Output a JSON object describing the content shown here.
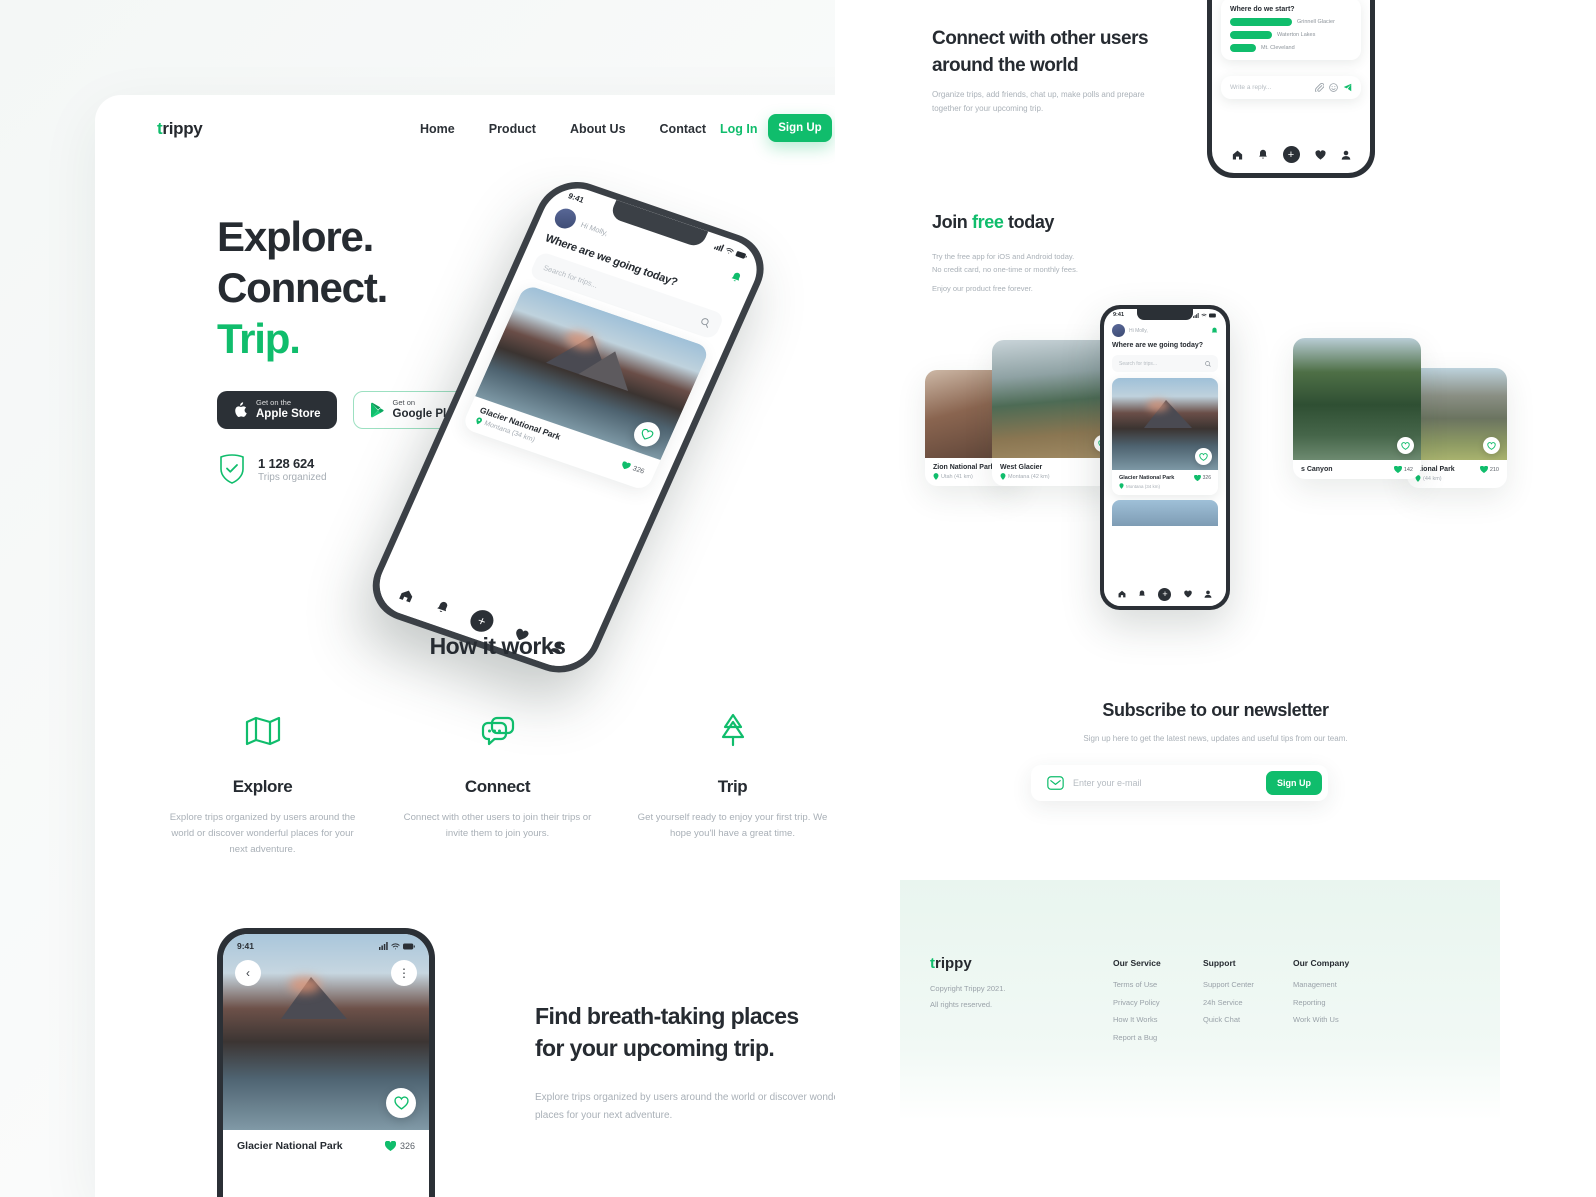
{
  "brand": {
    "name": "trippy",
    "first_letter": "t",
    "rest": "rippy",
    "accent_color": "#10bd6c"
  },
  "nav": {
    "links": [
      {
        "label": "Home"
      },
      {
        "label": "Product"
      },
      {
        "label": "About Us"
      },
      {
        "label": "Contact"
      }
    ],
    "login_label": "Log In",
    "signup_label": "Sign Up"
  },
  "hero": {
    "line1": "Explore.",
    "line2": "Connect.",
    "line3": "Trip.",
    "apple": {
      "small": "Get on the",
      "big": "Apple Store"
    },
    "google": {
      "small": "Get on",
      "big": "Google Play"
    },
    "stat_number": "1 128 624",
    "stat_label": "Trips organized"
  },
  "phone_app": {
    "time": "9:41",
    "greeting": "Hi Molly,",
    "title": "Where are we going today?",
    "search_placeholder": "Search for trips...",
    "card": {
      "name": "Glacier National Park",
      "location": "Montana (34 km)",
      "likes": "326"
    }
  },
  "how_it_works": {
    "title": "How it works",
    "items": [
      {
        "icon": "map-icon",
        "title": "Explore",
        "text": "Explore trips organized by users around the world or discover wonderful places for your next adventure."
      },
      {
        "icon": "chat-icon",
        "title": "Connect",
        "text": "Connect with other users to join their trips or invite them to join yours."
      },
      {
        "icon": "tree-icon",
        "title": "Trip",
        "text": "Get yourself ready to enjoy your first trip. We hope you'll have a great time."
      }
    ]
  },
  "feature": {
    "heading_line1": "Find breath-taking places",
    "heading_line2": "for your upcoming trip.",
    "text": "Explore trips organized by users around the world or discover wonderful places for your next adventure.",
    "phone": {
      "time": "9:41",
      "card_name": "Glacier National Park",
      "card_likes": "326"
    }
  },
  "connect_section": {
    "heading_line1": "Connect with other users",
    "heading_line2": "around the world",
    "text": "Organize trips, add friends, chat up, make polls and prepare together for your upcoming trip.",
    "poll": {
      "question": "Where do we start?",
      "options": [
        {
          "label": "Grinnell Glacier",
          "pct": 78
        },
        {
          "label": "Waterton Lakes",
          "pct": 52
        },
        {
          "label": "Mt. Cleveland",
          "pct": 30
        }
      ]
    },
    "reply_placeholder": "Write a reply..."
  },
  "join_section": {
    "heading_prefix": "Join ",
    "heading_accent": "free",
    "heading_suffix": " today",
    "text_line1": "Try the free app for iOS and Android today.",
    "text_line2": "No credit card, no one-time or monthly fees.",
    "text_line3": "Enjoy our product free forever."
  },
  "carousel": {
    "cards": [
      {
        "name": "Zion National Park",
        "location": "Utah (41 km)",
        "likes": ""
      },
      {
        "name": "West Glacier",
        "location": "Montana (42 km)",
        "likes": ""
      },
      {
        "name": "s Canyon",
        "location": "",
        "likes": "142"
      },
      {
        "name": "ational Park",
        "location": "(44 km)",
        "likes": "210"
      }
    ]
  },
  "newsletter": {
    "title": "Subscribe to our newsletter",
    "subtitle": "Sign up here to get the latest news, updates and useful tips from our team.",
    "placeholder": "Enter your e-mail",
    "button": "Sign Up"
  },
  "footer": {
    "copyright_line1": "Copyright Trippy 2021.",
    "copyright_line2": "All rights reserved.",
    "columns": [
      {
        "title": "Our Service",
        "links": [
          {
            "label": "Terms of Use"
          },
          {
            "label": "Privacy Policy"
          },
          {
            "label": "How It Works"
          },
          {
            "label": "Report a Bug"
          }
        ]
      },
      {
        "title": "Support",
        "links": [
          {
            "label": "Support Center"
          },
          {
            "label": "24h Service"
          },
          {
            "label": "Quick Chat"
          }
        ]
      },
      {
        "title": "Our Company",
        "links": [
          {
            "label": "Management"
          },
          {
            "label": "Reporting"
          },
          {
            "label": "Work With Us"
          }
        ]
      }
    ]
  }
}
